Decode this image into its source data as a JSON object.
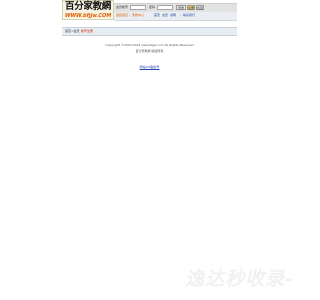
{
  "logo": {
    "text": "百分家教網",
    "url": "WWW.bfjjw.COM"
  },
  "login": {
    "username_label": "会员帐号",
    "password_label": "密码",
    "login_button": "登录",
    "register_button": "注册",
    "retrieve_button": "找回"
  },
  "nav": {
    "home": "返回首页",
    "teacher_center": "家教中心",
    "separator": "|",
    "items": [
      "首页",
      "会员",
      "说明"
    ],
    "contact": "联系我们"
  },
  "breadcrumb": {
    "first": "首页>会员",
    "second": "帐号注册"
  },
  "footer": {
    "copyright": "Copyright ©2003-2024 www.bfjjw.com All Rights Reserved",
    "org": "百分家教網 版权所有",
    "link": "网站ICP备案号"
  },
  "watermark": {
    "text": "逸达秒收录-"
  },
  "colors": {
    "link_blue": "#2244aa",
    "nav_orange": "#e05a00",
    "bar_gray": "#e2e2e2"
  }
}
